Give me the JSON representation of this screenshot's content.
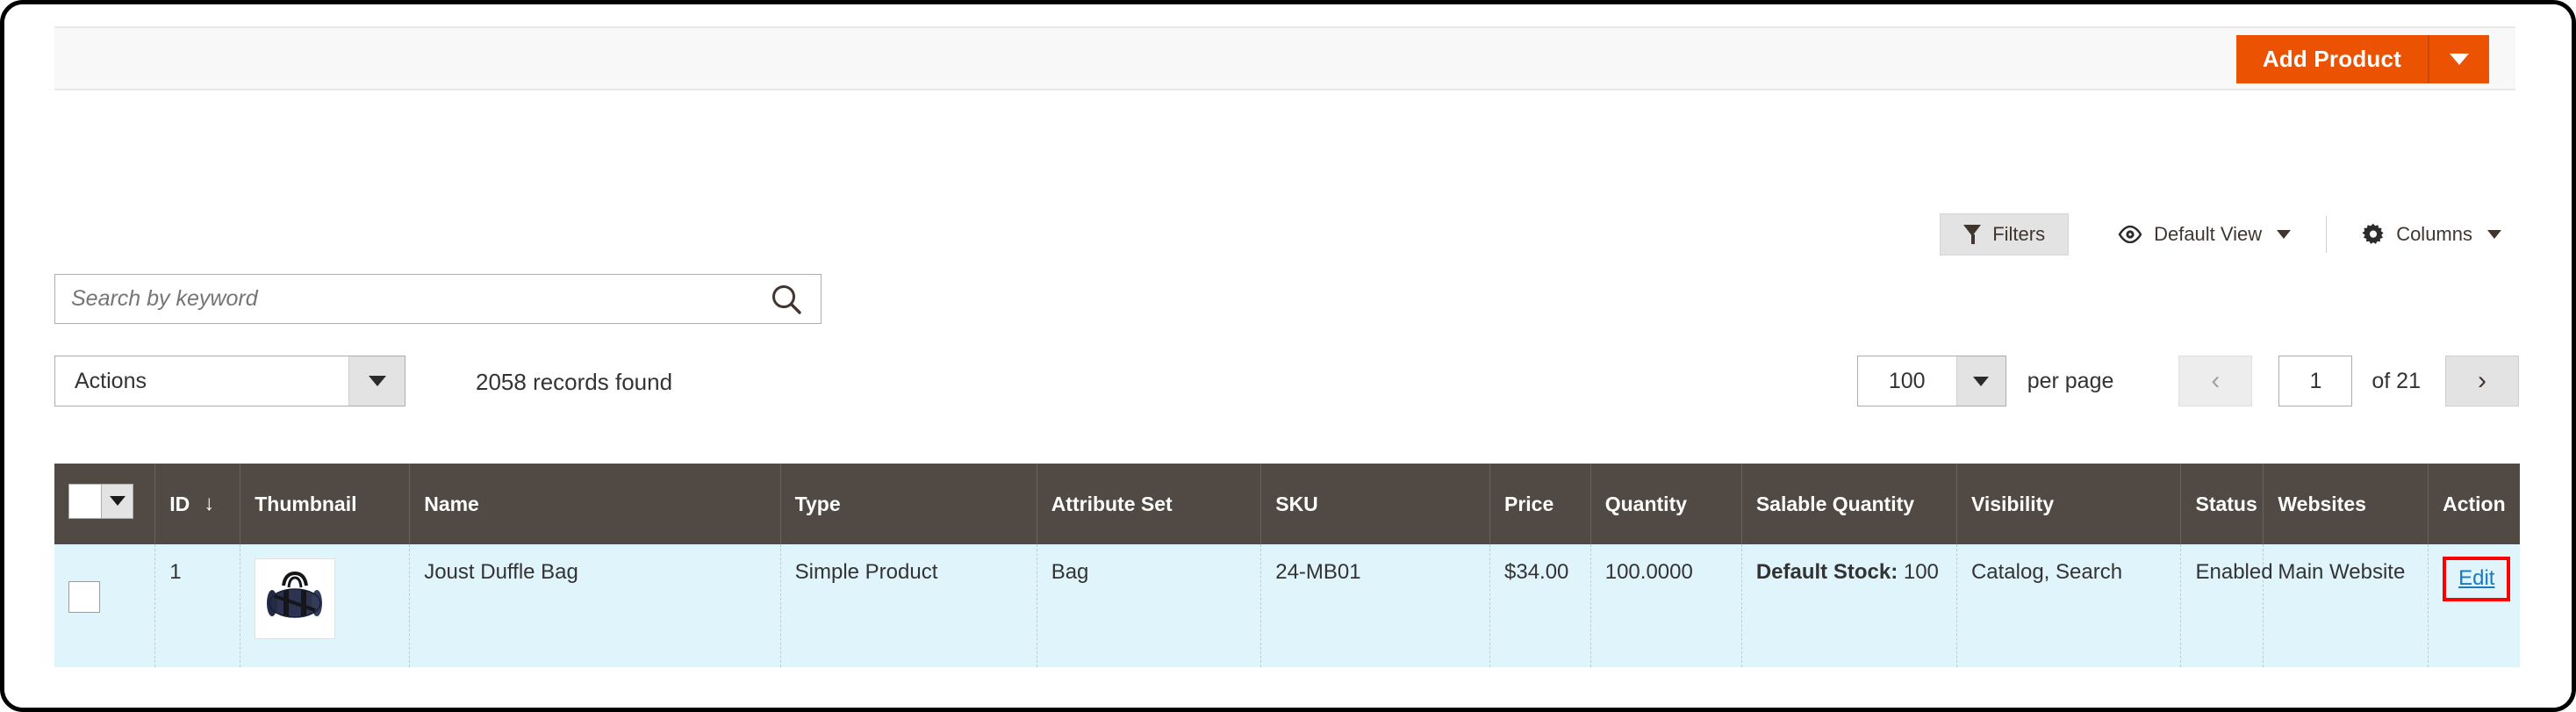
{
  "header": {
    "add_product_label": "Add Product",
    "add_product_caret_icon": "chevron-down-icon"
  },
  "toolbar": {
    "filters_label": "Filters",
    "filters_icon": "funnel-icon",
    "view_label": "Default View",
    "view_icon": "eye-icon",
    "columns_label": "Columns",
    "columns_icon": "gear-icon"
  },
  "search": {
    "placeholder": "Search by keyword",
    "value": "",
    "icon": "search-icon"
  },
  "actions": {
    "label": "Actions",
    "caret_icon": "chevron-down-icon"
  },
  "records_found": "2058 records found",
  "pager": {
    "per_page_value": "100",
    "per_page_label": "per page",
    "prev_icon": "‹",
    "next_icon": "›",
    "current_page": "1",
    "total_pages_label": "of 21"
  },
  "grid": {
    "columns": [
      {
        "label": "",
        "key": "checkbox"
      },
      {
        "label": "ID",
        "key": "id",
        "sorted": "asc",
        "sort_icon": "↓"
      },
      {
        "label": "Thumbnail",
        "key": "thumbnail"
      },
      {
        "label": "Name",
        "key": "name"
      },
      {
        "label": "Type",
        "key": "type"
      },
      {
        "label": "Attribute Set",
        "key": "attribute_set"
      },
      {
        "label": "SKU",
        "key": "sku"
      },
      {
        "label": "Price",
        "key": "price"
      },
      {
        "label": "Quantity",
        "key": "quantity"
      },
      {
        "label": "Salable Quantity",
        "key": "salable_quantity"
      },
      {
        "label": "Visibility",
        "key": "visibility"
      },
      {
        "label": "Status",
        "key": "status"
      },
      {
        "label": "Websites",
        "key": "websites"
      },
      {
        "label": "Action",
        "key": "action"
      }
    ],
    "rows": [
      {
        "id": "1",
        "thumbnail_alt": "Joust Duffle Bag thumbnail",
        "name": "Joust Duffle Bag",
        "type": "Simple Product",
        "attribute_set": "Bag",
        "sku": "24-MB01",
        "price": "$34.00",
        "quantity": "100.0000",
        "salable_stock_label": "Default Stock:",
        "salable_stock_value": "100",
        "visibility": "Catalog, Search",
        "status": "Enabled",
        "websites": "Main Website",
        "action_label": "Edit"
      }
    ]
  },
  "colors": {
    "accent_orange": "#eb5202",
    "grid_header": "#514943",
    "row_highlight": "#e0f4fc",
    "link_blue": "#1979c3",
    "annotation_red": "#ff0000"
  }
}
